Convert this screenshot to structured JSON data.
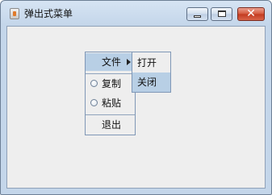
{
  "window": {
    "title": "弹出式菜单",
    "close_glyph": "✕"
  },
  "popup_menu": {
    "file_label": "文件",
    "copy_label": "复制",
    "paste_label": "粘贴",
    "exit_label": "退出"
  },
  "file_submenu": {
    "open_label": "打开",
    "close_label": "关闭"
  },
  "colors": {
    "selection": "#b8cfe5",
    "content_bg": "#eeeeee",
    "close_button": "#c8442a"
  }
}
